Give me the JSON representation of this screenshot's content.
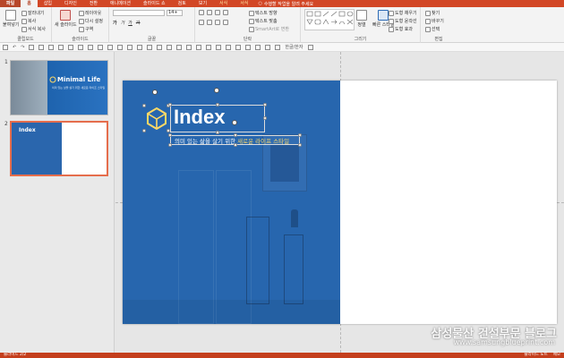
{
  "tabs": [
    {
      "label": "파일",
      "kind": "file"
    },
    {
      "label": "홈",
      "kind": "home"
    },
    {
      "label": "삽입",
      "kind": ""
    },
    {
      "label": "디자인",
      "kind": ""
    },
    {
      "label": "전환",
      "kind": ""
    },
    {
      "label": "애니메이션",
      "kind": ""
    },
    {
      "label": "슬라이드 쇼",
      "kind": ""
    },
    {
      "label": "검토",
      "kind": ""
    },
    {
      "label": "보기",
      "kind": ""
    },
    {
      "label": "서식",
      "kind": "ctx"
    },
    {
      "label": "서식",
      "kind": "ctx"
    }
  ],
  "tell_me": "수행할 작업을 알려 주세요",
  "ribbon": {
    "clipboard": {
      "paste": "붙여넣기",
      "cut": "잘라내기",
      "copy": "복사",
      "format_painter": "서식 복사",
      "label": "클립보드"
    },
    "slides": {
      "new_slide": "새 슬라이드",
      "layout": "레이아웃",
      "reset": "다시 설정",
      "section": "구역",
      "label": "슬라이드"
    },
    "font": {
      "size": "14+",
      "label": "글꼴"
    },
    "paragraph": {
      "text_direction": "텍스트 방향",
      "align_text": "텍스트 맞춤",
      "smartart": "SmartArt로 변환",
      "label": "단락"
    },
    "drawing": {
      "arrange": "정렬",
      "quick_styles": "빠른 스타일",
      "fill": "도형 채우기",
      "outline": "도형 윤곽선",
      "effects": "도형 효과",
      "label": "그리기"
    },
    "editing": {
      "find": "찾기",
      "replace": "바꾸기",
      "select": "선택",
      "label": "편집"
    }
  },
  "qat": {
    "hanja": "한글/한자"
  },
  "thumbnails": [
    {
      "num": "1",
      "title": "Minimal Life",
      "subtitle": "의미 있는 삶을 살기 위한 새로운 라이프 스타일"
    },
    {
      "num": "2",
      "title": "Index"
    }
  ],
  "slide": {
    "title": "Index",
    "subtitle_plain": "의미 있는 삶을 살기 위한 ",
    "subtitle_highlight": "새로운 라이프 스타일",
    "blue": "#2766ae",
    "accent": "#ffd966"
  },
  "watermark": {
    "line1": "삼성물산 건설부문 블로그",
    "line2": "www.samsungblueprint.com"
  },
  "status": {
    "slide_info": "슬라이드 2/2",
    "notes": "슬라이드 노트",
    "comments": "메모"
  }
}
